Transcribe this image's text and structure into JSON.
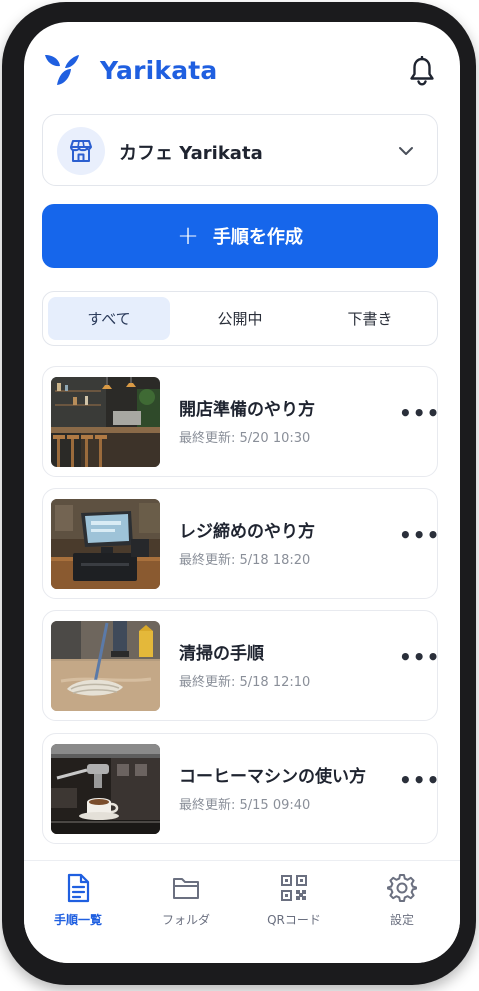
{
  "app": {
    "title": "Yarikata"
  },
  "store": {
    "name": "カフェ Yarikata"
  },
  "actions": {
    "create_label": "手順を作成"
  },
  "tabs": [
    {
      "label": "すべて",
      "active": true
    },
    {
      "label": "公開中",
      "active": false
    },
    {
      "label": "下書き",
      "active": false
    }
  ],
  "procedures": [
    {
      "title": "開店準備のやり方",
      "updated": "最終更新: 5/20 10:30",
      "image": "cafe-counter"
    },
    {
      "title": "レジ締めのやり方",
      "updated": "最終更新: 5/18 18:20",
      "image": "pos-register"
    },
    {
      "title": "清掃の手順",
      "updated": "最終更新: 5/18 12:10",
      "image": "mop-floor"
    },
    {
      "title": "コーヒーマシンの使い方",
      "updated": "最終更新: 5/15 09:40",
      "image": "espresso-machine"
    }
  ],
  "more_label": "•••",
  "nav": [
    {
      "label": "手順一覧",
      "icon": "document-icon",
      "active": true
    },
    {
      "label": "フォルダ",
      "icon": "folder-icon",
      "active": false
    },
    {
      "label": "QRコード",
      "icon": "qr-code-icon",
      "active": false
    },
    {
      "label": "設定",
      "icon": "gear-icon",
      "active": false
    }
  ],
  "colors": {
    "brand": "#1f5fe0",
    "primary_button": "#1666eb",
    "active_tab_bg": "#e6eefc"
  }
}
